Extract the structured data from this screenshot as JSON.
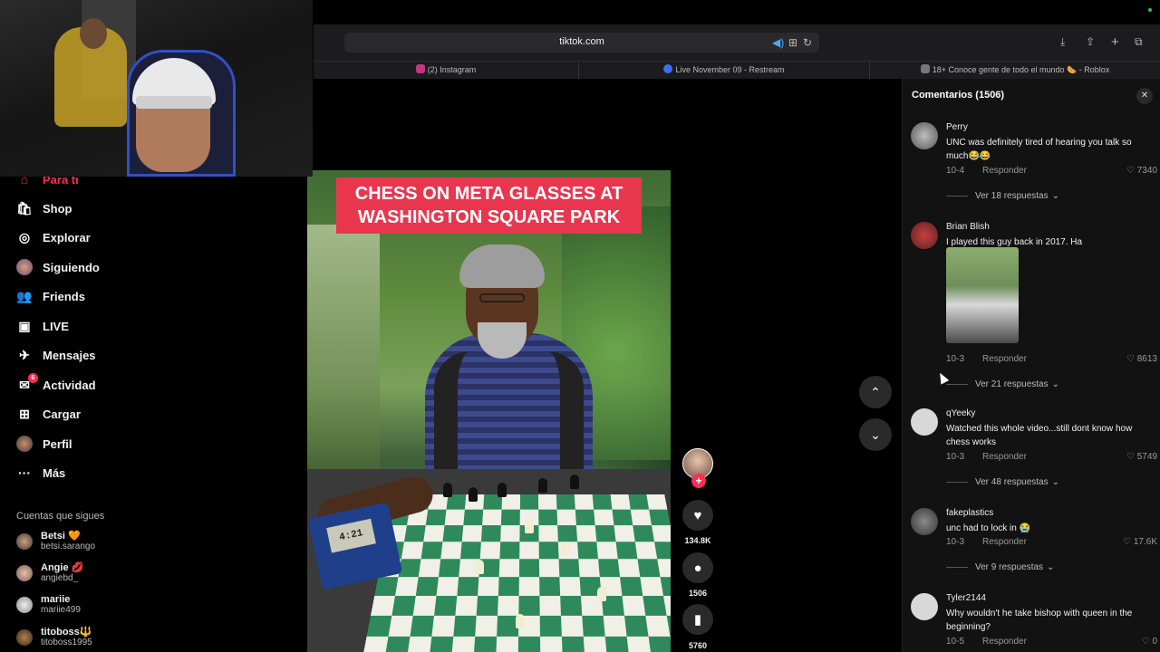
{
  "browser": {
    "url": "tiktok.com",
    "tabs": [
      {
        "label": "(2) Instagram",
        "color": "#c13584"
      },
      {
        "label": "Live November 09 - Restream",
        "color": "#3a6ff0"
      },
      {
        "label": "18+ Conoce gente de todo el mundo 🌭 - Roblox",
        "color": "#777777"
      }
    ]
  },
  "sidebar": {
    "items": [
      {
        "label": "Para ti",
        "icon": "home-icon"
      },
      {
        "label": "Shop",
        "icon": "shop-icon"
      },
      {
        "label": "Explorar",
        "icon": "compass-icon"
      },
      {
        "label": "Siguiendo",
        "icon": "following-avatar-icon"
      },
      {
        "label": "Friends",
        "icon": "friends-icon"
      },
      {
        "label": "LIVE",
        "icon": "live-icon"
      },
      {
        "label": "Mensajes",
        "icon": "messages-icon"
      },
      {
        "label": "Actividad",
        "icon": "activity-icon",
        "badge": "6"
      },
      {
        "label": "Cargar",
        "icon": "upload-icon"
      },
      {
        "label": "Perfil",
        "icon": "profile-avatar-icon"
      },
      {
        "label": "Más",
        "icon": "more-icon"
      }
    ],
    "following_title": "Cuentas que sigues",
    "following": [
      {
        "name": "Betsi 🧡",
        "handle": "betsi.sarango"
      },
      {
        "name": "Angie 💋",
        "handle": "angiebd_"
      },
      {
        "name": "mariie",
        "handle": "mariie499"
      },
      {
        "name": "titoboss🔱",
        "handle": "titoboss1995"
      }
    ]
  },
  "video": {
    "caption_line1": "CHESS ON META GLASSES AT",
    "caption_line2": "WASHINGTON SQUARE PARK",
    "clock": "4:21"
  },
  "actions": {
    "likes": "134.8K",
    "comments": "1506",
    "saves": "5760"
  },
  "comments": {
    "title": "Comentarios (1506)",
    "reply_label": "Responder",
    "items": [
      {
        "user": "Perry",
        "text": "UNC was definitely tired of hearing you talk so much😂😂",
        "date": "10-4",
        "likes": "7340",
        "more": "Ver 18 respuestas"
      },
      {
        "user": "Brian Blish",
        "text": "I played this guy back in 2017. Ha",
        "date": "10-3",
        "likes": "8613",
        "more": "Ver 21 respuestas"
      },
      {
        "user": "qYeeky",
        "text": "Watched this whole video...still dont know how chess works",
        "date": "10-3",
        "likes": "5749",
        "more": "Ver 48 respuestas"
      },
      {
        "user": "fakeplastics",
        "text": "unc had to lock in 😭",
        "date": "10-3",
        "likes": "17.6K",
        "more": "Ver 9 respuestas"
      },
      {
        "user": "Tyler2144",
        "text": "Why wouldn't he take bishop with queen in the beginning?",
        "date": "10-5",
        "likes": "0",
        "more": ""
      }
    ]
  },
  "colors": {
    "accent": "#fe2c55",
    "panel": "#121212"
  }
}
